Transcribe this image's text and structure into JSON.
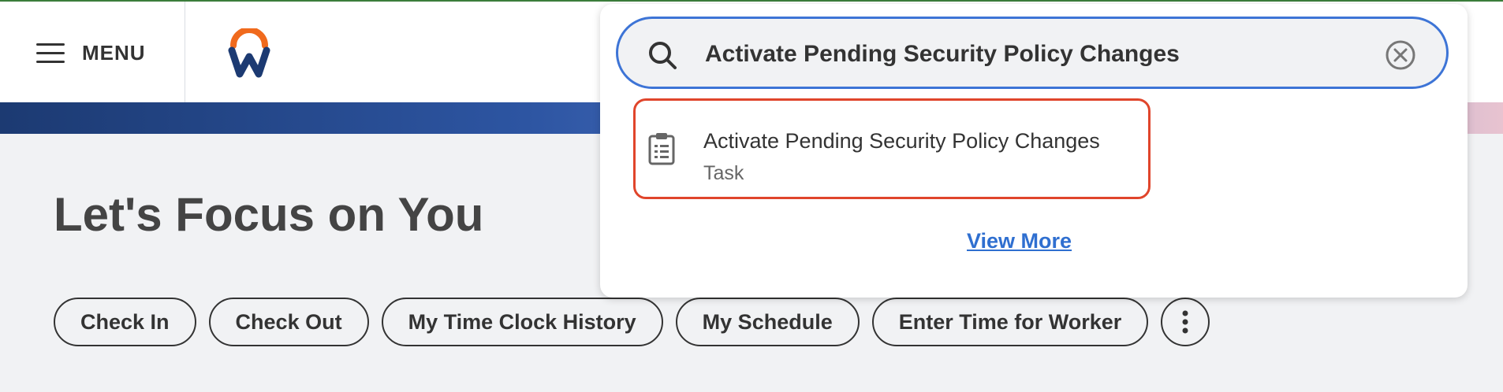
{
  "header": {
    "menu_label": "MENU"
  },
  "main": {
    "title": "Let's Focus on You",
    "actions": [
      {
        "label": "Check In"
      },
      {
        "label": "Check Out"
      },
      {
        "label": "My Time Clock History"
      },
      {
        "label": "My Schedule"
      },
      {
        "label": "Enter Time for Worker"
      }
    ]
  },
  "search": {
    "value": "Activate Pending Security Policy Changes",
    "results": [
      {
        "title": "Activate Pending Security Policy Changes",
        "type": "Task",
        "icon": "clipboard-list-icon"
      }
    ],
    "view_more": "View More"
  },
  "icons": {
    "menu": "hamburger-icon",
    "logo": "workday-logo",
    "search": "search-icon",
    "clear": "close-circle-icon",
    "more": "more-vertical-icon"
  },
  "colors": {
    "search_border": "#3d74d6",
    "result_highlight": "#e0452b",
    "link": "#2f6fd0",
    "logo_orange": "#f06a1d",
    "logo_blue": "#1c3a72"
  }
}
